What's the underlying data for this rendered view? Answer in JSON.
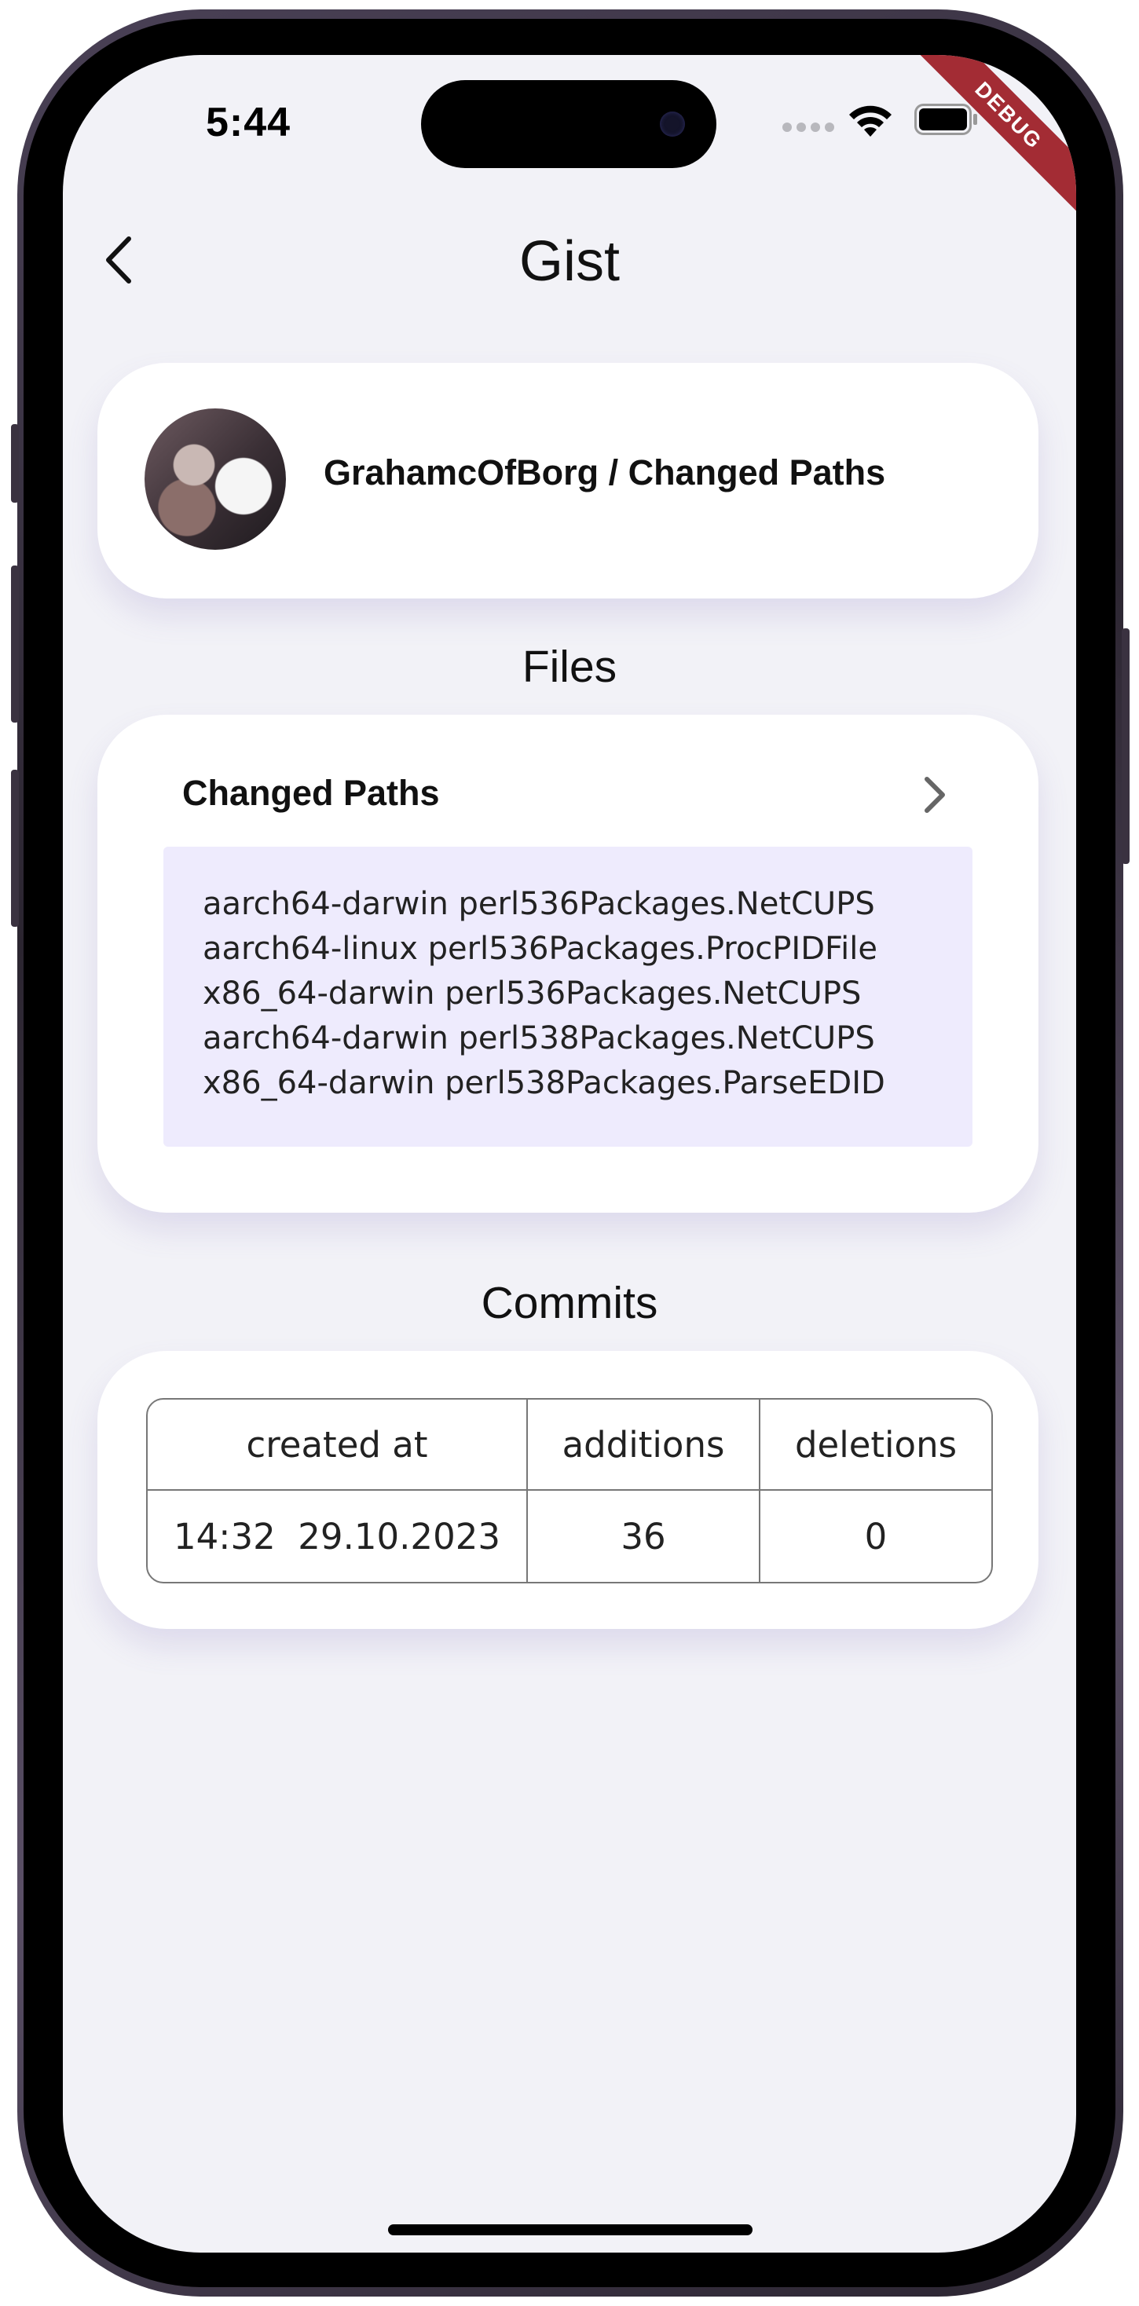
{
  "status_bar": {
    "time": "5:44",
    "debug_label": "DEBUG"
  },
  "header": {
    "title": "Gist"
  },
  "gist": {
    "heading": "GrahamcOfBorg / Changed Paths"
  },
  "files_section": {
    "title": "Files",
    "files": [
      {
        "name": "Changed Paths",
        "lines": [
          "aarch64-darwin perl536Packages.NetCUPS",
          "aarch64-linux perl536Packages.ProcPIDFile",
          "x86_64-darwin perl536Packages.NetCUPS",
          "aarch64-darwin perl538Packages.NetCUPS",
          "x86_64-darwin perl538Packages.ParseEDID"
        ]
      }
    ]
  },
  "commits_section": {
    "title": "Commits",
    "columns": [
      "created at",
      "additions",
      "deletions"
    ],
    "rows": [
      {
        "created_at": "14:32  29.10.2023",
        "additions": "36",
        "deletions": "0"
      }
    ]
  },
  "icons": {
    "back": "chevron-left-icon",
    "file_open": "chevron-right-icon",
    "wifi": "wifi-icon",
    "battery": "battery-icon"
  }
}
